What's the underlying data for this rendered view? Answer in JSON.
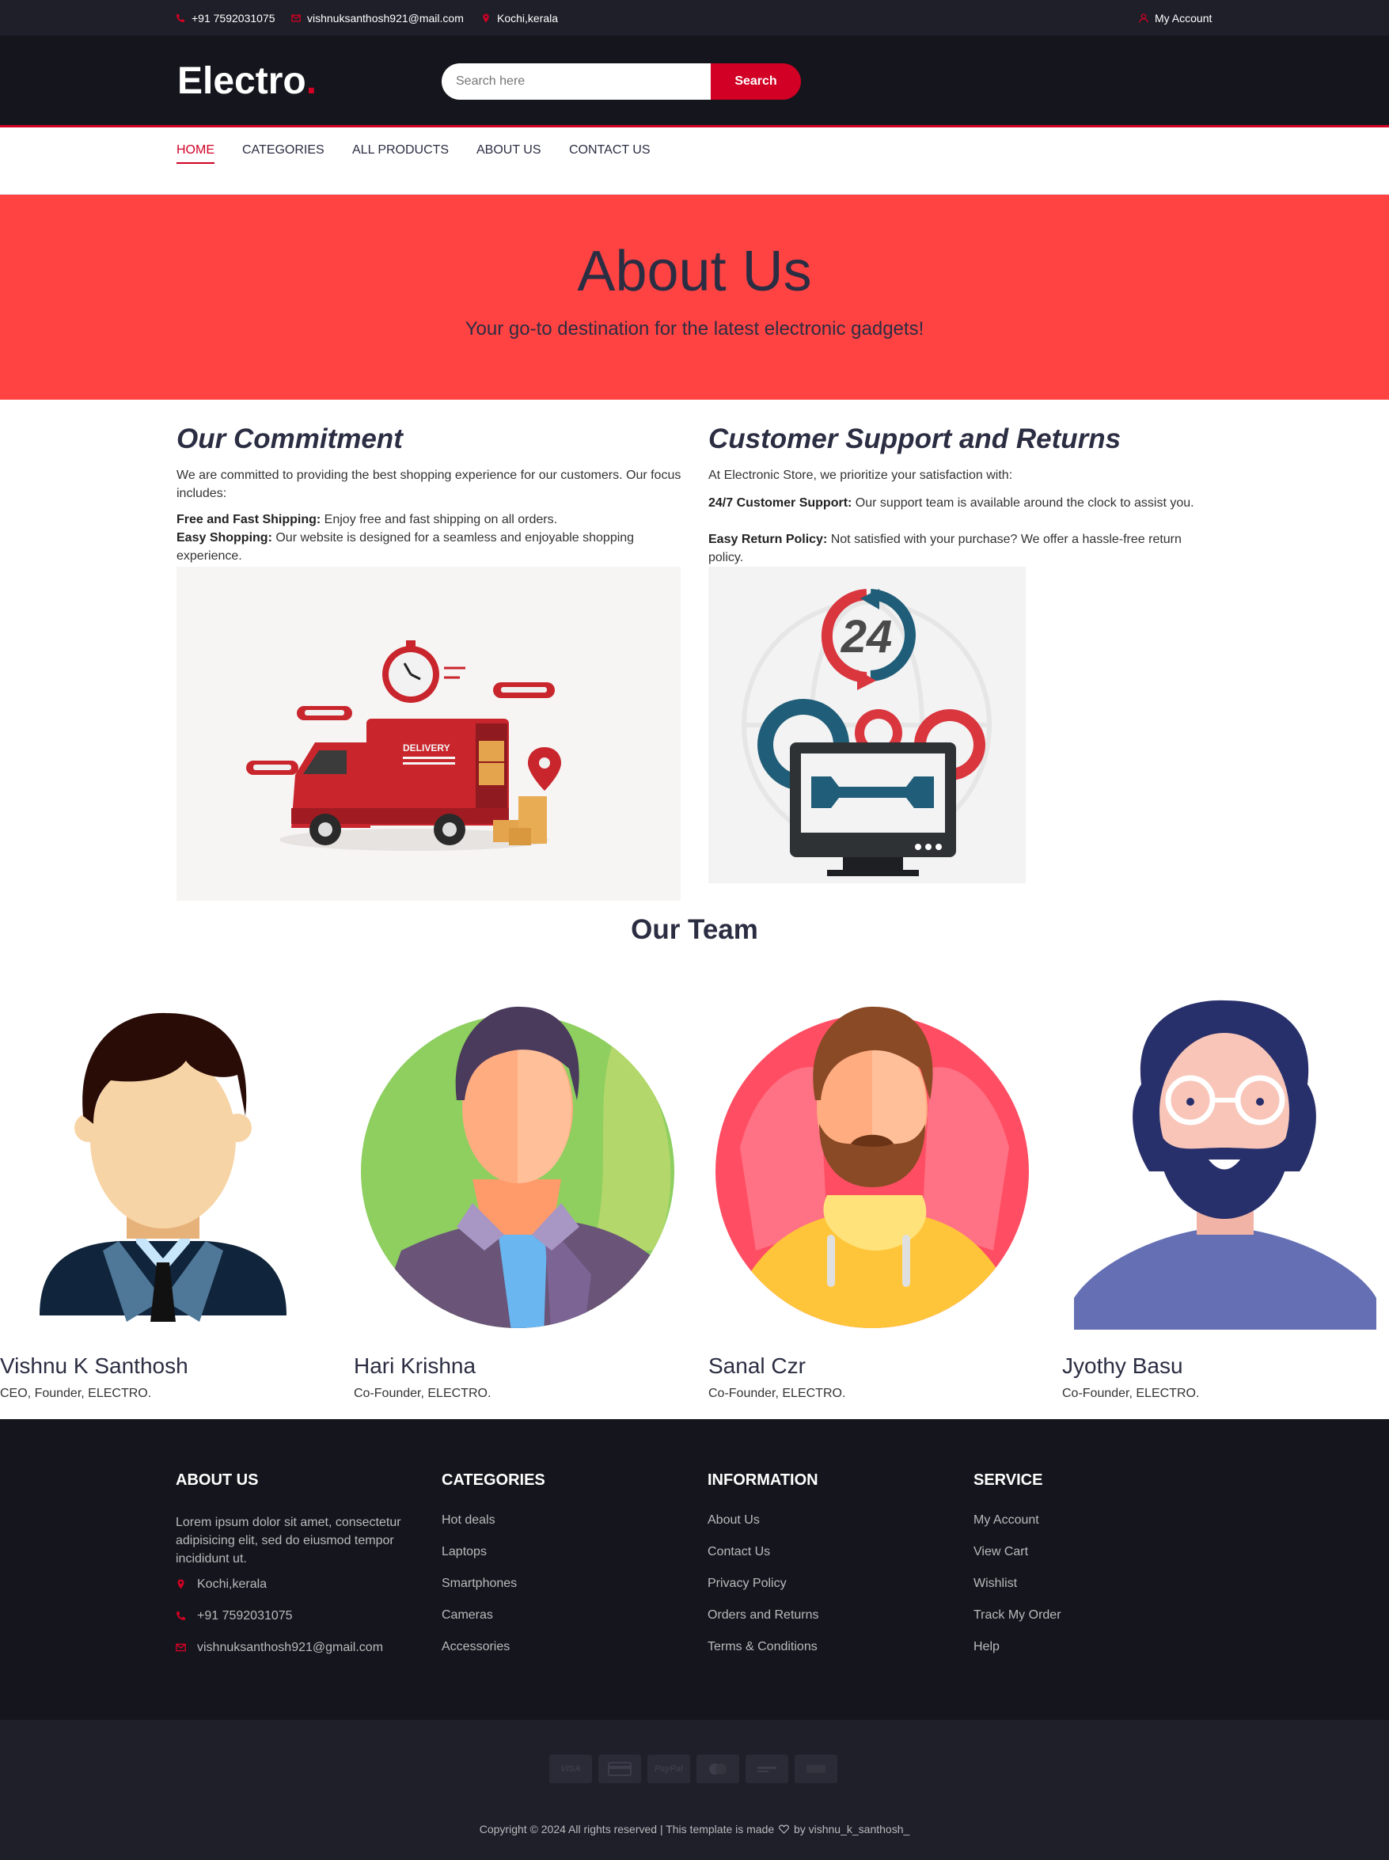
{
  "topbar": {
    "phone": "+91 7592031075",
    "email": "vishnuksanthosh921@mail.com",
    "location": "Kochi,kerala",
    "account": "My Account"
  },
  "header": {
    "logo": "Electro",
    "logo_dot": ".",
    "search_placeholder": "Search here",
    "search_button": "Search"
  },
  "nav": {
    "items": [
      "HOME",
      "CATEGORIES",
      "ALL PRODUCTS",
      "ABOUT US",
      "CONTACT US"
    ],
    "active": "HOME"
  },
  "hero": {
    "title": "About Us",
    "subtitle": "Your go-to destination for the latest electronic gadgets!"
  },
  "commitment": {
    "title": "Our Commitment",
    "intro": "We are committed to providing the best shopping experience for our customers. Our focus includes:",
    "point1_label": "Free and Fast Shipping:",
    "point1_text": " Enjoy free and fast shipping on all orders.",
    "point2_label": "Easy Shopping:",
    "point2_text": " Our website is designed for a seamless and enjoyable shopping experience.",
    "image_label": "DELIVERY"
  },
  "support": {
    "title": "Customer Support and Returns",
    "intro": "At Electronic Store, we prioritize your satisfaction with:",
    "point1_label": "24/7 Customer Support:",
    "point1_text": " Our support team is available around the clock to assist you.",
    "point2_label": "Easy Return Policy:",
    "point2_text": " Not satisfied with your purchase? We offer a hassle-free return policy.",
    "image_label": "24"
  },
  "team": {
    "title": "Our Team",
    "members": [
      {
        "name": "Vishnu K Santhosh",
        "role": "CEO, Founder, ELECTRO."
      },
      {
        "name": "Hari Krishna",
        "role": "Co-Founder, ELECTRO."
      },
      {
        "name": "Sanal Czr",
        "role": "Co-Founder, ELECTRO."
      },
      {
        "name": "Jyothy Basu",
        "role": "Co-Founder, ELECTRO."
      }
    ]
  },
  "footer": {
    "about": {
      "title": "ABOUT US",
      "text": "Lorem ipsum dolor sit amet, consectetur adipisicing elit, sed do eiusmod tempor incididunt ut.",
      "location": "Kochi,kerala",
      "phone": "+91 7592031075",
      "email": "vishnuksanthosh921@gmail.com"
    },
    "categories": {
      "title": "CATEGORIES",
      "items": [
        "Hot deals",
        "Laptops",
        "Smartphones",
        "Cameras",
        "Accessories"
      ]
    },
    "information": {
      "title": "INFORMATION",
      "items": [
        "About Us",
        "Contact Us",
        "Privacy Policy",
        "Orders and Returns",
        "Terms & Conditions"
      ]
    },
    "service": {
      "title": "SERVICE",
      "items": [
        "My Account",
        "View Cart",
        "Wishlist",
        "Track My Order",
        "Help"
      ]
    }
  },
  "payments": [
    "VISA",
    "",
    "PayPal",
    "",
    "",
    ""
  ],
  "copyright_prefix": "Copyright © 2024 All rights reserved | This template is made",
  "copyright_suffix": "by vishnu_k_santhosh_",
  "colors": {
    "accent": "#d10024",
    "dark": "#15161d",
    "hero": "#ff4343"
  }
}
